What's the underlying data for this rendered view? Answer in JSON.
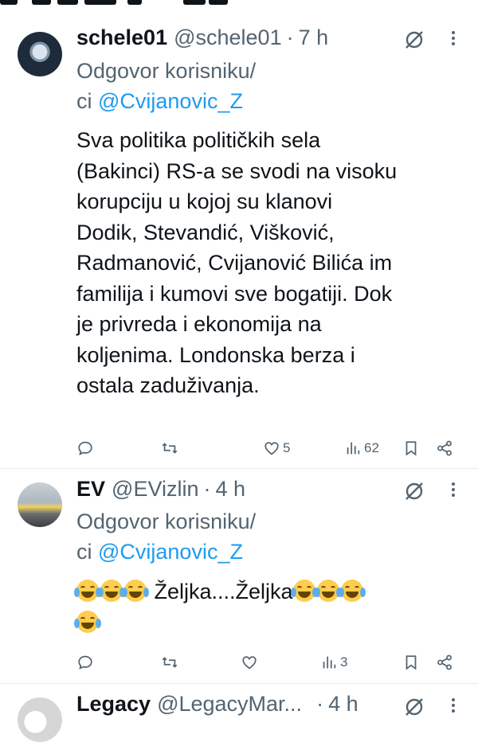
{
  "tweets": [
    {
      "name": "schele01",
      "handle": "@schele01",
      "dot": "·",
      "time": "7 h",
      "reply_prefix": "Odgovor korisniku/",
      "reply_ci": "ci ",
      "reply_mention": "@Cvijanovic_Z",
      "text": "Sva politika političkih sela\n(Bakinci) RS-a se svodi na visoku\nkorupciju u kojoj su klanovi\nDodik, Stevandić, Višković,\nRadmanović, Cvijanović Bilića im\nfamilija i kumovi sve bogatiji. Dok\nje privreda i ekonomija na\nkoljenima. Londonska berza i\nostala zaduživanja.",
      "likes": "5",
      "views": "62",
      "icons": [
        "reply-icon",
        "retweet-icon",
        "heart-icon",
        "views-icon",
        "bookmark-icon",
        "share-icon"
      ]
    },
    {
      "name": "EV",
      "handle": "@EVizlin",
      "dot": "·",
      "time": "4 h",
      "reply_prefix": "Odgovor korisniku/",
      "reply_ci": "ci ",
      "reply_mention": "@Cvijanovic_Z",
      "text_middle": " Željka....Željka",
      "emoji_name": "face-with-tears-of-joy",
      "likes": "",
      "views": "3"
    },
    {
      "name": "Legacy",
      "handle": "@LegacyMar...",
      "dot": "·",
      "time": "4 h"
    }
  ],
  "colors": {
    "text": "#0f1419",
    "secondary": "#536471",
    "mention": "#1d9bf0",
    "divider": "#e6e9ec"
  }
}
